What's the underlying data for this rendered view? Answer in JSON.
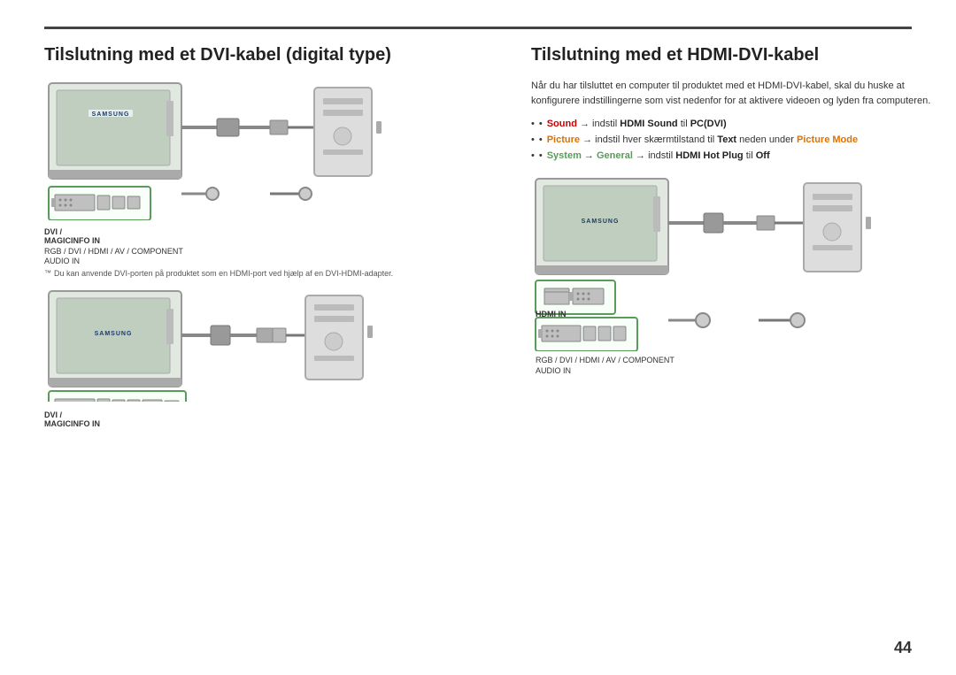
{
  "page": {
    "number": "44",
    "top_rule": true
  },
  "left_section": {
    "title": "Tilslutning med et DVI-kabel (digital type)",
    "diagrams": [
      {
        "id": "diagram1",
        "monitor_brand": "SAMSUNG",
        "port_label_1": "DVI /",
        "port_label_2": "MAGICINFO IN",
        "port_label_3": "RGB / DVI / HDMI / AV / COMPONENT",
        "port_label_4": "AUDIO IN"
      },
      {
        "id": "diagram2",
        "monitor_brand": "SAMSUNG",
        "port_label_1": "DVI /",
        "port_label_2": "MAGICINFO IN"
      }
    ],
    "note": "Du kan anvende DVI-porten på produktet som en HDMI-port ved hjælp af en DVI-HDMI-adapter."
  },
  "right_section": {
    "title": "Tilslutning med et HDMI-DVI-kabel",
    "description": "Når du har tilsluttet en computer til produktet med et HDMI-DVI-kabel, skal du huske at konfigurere indstillingerne som vist nedenfor for at aktivere videoen og lyden fra computeren.",
    "bullets": [
      {
        "prefix": "Sound",
        "arrow": " → indstil ",
        "bold1": "HDMI Sound",
        "middle": " til ",
        "bold2": "PC(DVI)",
        "color": "red"
      },
      {
        "prefix": "Picture",
        "arrow": " → indstil hver skærmtilstand til ",
        "bold1": "Text",
        "middle": " neden under ",
        "bold2": "Picture Mode",
        "color": "orange"
      },
      {
        "prefix": "System",
        "arrow": " → ",
        "bold1": "General",
        "middle": " → indstil ",
        "bold2": "HDMI Hot Plug",
        "suffix": " til ",
        "bold3": "Off",
        "color": "green"
      }
    ],
    "diagram": {
      "monitor_brand": "SAMSUNG",
      "port_label_1": "HDMI IN",
      "port_label_2": "RGB / DVI / HDMI / AV / COMPONENT",
      "port_label_3": "AUDIO IN"
    }
  }
}
